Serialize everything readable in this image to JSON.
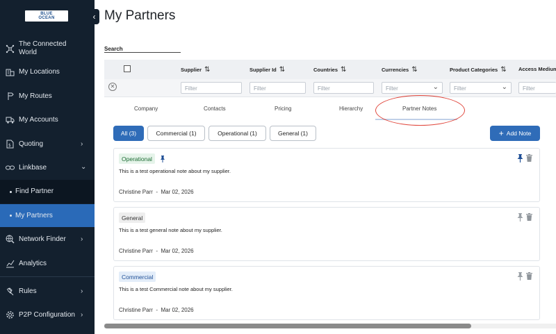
{
  "logo": {
    "line1": "BLUE",
    "line2": "OCEAN"
  },
  "sidebar": {
    "items": [
      {
        "label_line1": "The Connected",
        "label_line2": "World",
        "icon": "network-icon"
      },
      {
        "label": "My Locations",
        "icon": "building-icon"
      },
      {
        "label": "My Routes",
        "icon": "route-icon"
      },
      {
        "label": "My Accounts",
        "icon": "truck-icon"
      },
      {
        "label": "Quoting",
        "icon": "document-icon",
        "has_children": true
      },
      {
        "label": "Linkbase",
        "icon": "link-icon",
        "expanded": true
      },
      {
        "label": "Find Partner",
        "sub": true
      },
      {
        "label": "My Partners",
        "sub": true,
        "active": true
      },
      {
        "label": "Network Finder",
        "icon": "globe-search-icon",
        "has_children": true
      },
      {
        "label": "Analytics",
        "icon": "chart-icon"
      },
      {
        "label": "Rules",
        "icon": "gavel-icon",
        "has_children": true
      },
      {
        "label": "P2P Configuration",
        "icon": "gear-icon",
        "has_children": true
      }
    ]
  },
  "page": {
    "title": "My Partners"
  },
  "search": {
    "label": "Search"
  },
  "grid": {
    "columns": [
      "Supplier",
      "Supplier Id",
      "Countries",
      "Currencies",
      "Product Categories",
      "Access Medium"
    ],
    "filter_placeholder": "Filter"
  },
  "tabs": [
    "Company",
    "Contacts",
    "Pricing",
    "Hierarchy",
    "Partner Notes"
  ],
  "active_tab": "Partner Notes",
  "chips": [
    "All (3)",
    "Commercial (1)",
    "Operational (1)",
    "General (1)"
  ],
  "add_note_label": "Add Note",
  "notes": [
    {
      "type": "Operational",
      "text": "This is a test operational note about my supplier.",
      "author": "Christine Parr",
      "date": "Mar 02, 2026",
      "pinned": true
    },
    {
      "type": "General",
      "text": "This is a test general note about my supplier.",
      "author": "Christine Parr",
      "date": "Mar 02, 2026",
      "pinned": false
    },
    {
      "type": "Commercial",
      "text": "This is a test Commercial note about my supplier.",
      "author": "Christine Parr",
      "date": "Mar 02, 2026",
      "pinned": false
    }
  ],
  "meta_separator": "-",
  "colors": {
    "sidebar_bg": "#13202e",
    "accent": "#2f6cb8",
    "highlight_ring": "#e0453a",
    "pin_active": "#1f4f96",
    "pin_inactive": "#9aa0a6"
  }
}
